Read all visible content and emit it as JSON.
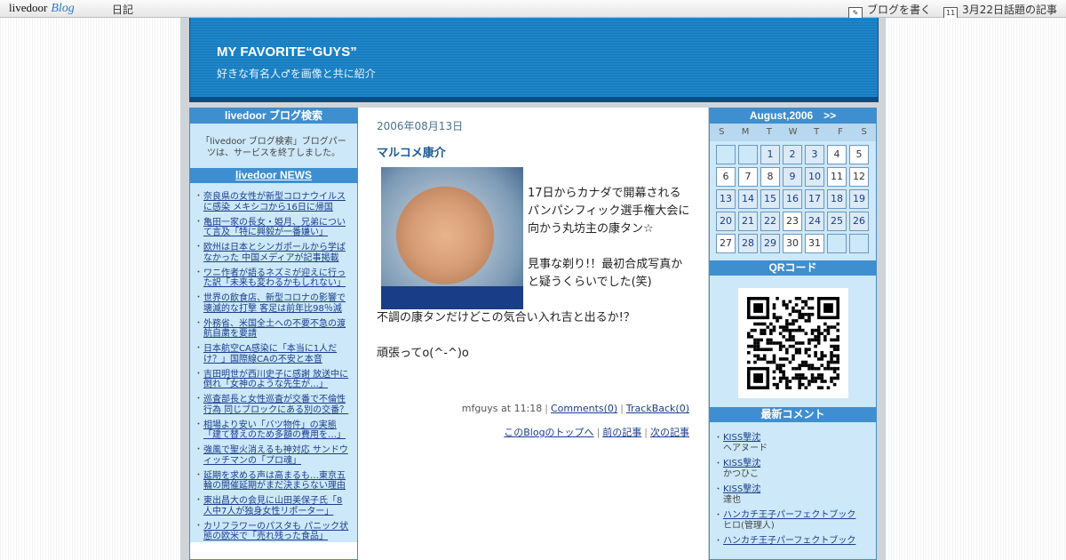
{
  "topbar": {
    "logo_main": "livedoor",
    "logo_blog": "Blog",
    "nav_diary": "日記",
    "write_blog": "ブログを書く",
    "topic_article": "3月22日話題の記事",
    "calendar_icon_day": "11"
  },
  "header": {
    "title": "MY FAVORITE“GUYS”",
    "description": "好きな有名人♂を画像と共に紹介"
  },
  "left": {
    "search_head": "livedoor ブログ検索",
    "search_message": "「livedoor ブログ検索」ブログパーツは、サービスを終了しました。",
    "news_head": "livedoor NEWS",
    "news": [
      "奈良県の女性が新型コロナウイルスに感染 メキシコから16日に帰国",
      "亀田一家の長女・姫月、兄弟について言及「特に興毅が一番嫌い」",
      "欧州は日本とシンガポールから学ばなかった 中国メディアが記事掲載",
      "ワニ作者が語るネズミが迎えに行った訳「未来も変わるかもしれない」",
      "世界の飲食店、新型コロナの影響で壊滅的な打撃 客足は前年比98％減",
      "外務省、米国全土への不要不急の渡航自粛を要請",
      "日本航空CA感染に「本当に1人だけ？」国際線CAの不安と本音",
      "吉田明世が西川史子に感謝 放送中に倒れ「女神のような先生が…」",
      "巡査部長と女性巡査が交番で不倫性行為 同じブロックにある別の交番？",
      "相場より安い「バツ物件」の実態「建て替えのため多額の費用を…」",
      "強風で聖火消えるも神対応 サンドウィッチマンの「プロ魂」",
      "延期を求める声は高まるも…東京五輪の開催延期がまだ決まらない理由",
      "東出昌大の会見に山田美保子氏「8人中7人が独身女性リポーター」",
      "カリフラワーのパスタも パニック状態の欧米で「売れ残った食品」"
    ]
  },
  "post": {
    "date": "2006年08月13日",
    "title": "マルコメ康介",
    "text1": "17日からカナダで開幕されるパンパシフィック選手権大会に向かう丸坊主の康タン☆",
    "text2": "見事な剃り!！最初合成写真かと疑うくらいでした(笑)",
    "text3": "不調の康タンだけどこの気合い入れ吉と出るか!？",
    "text4": "頑張ってo(^-^)o",
    "author_time": "mfguys at 11:18",
    "comments": "Comments(0)",
    "trackback": "TrackBack(0)",
    "nav_top": "このBlogのトップへ",
    "nav_prev": "前の記事",
    "nav_next": "次の記事"
  },
  "right": {
    "calendar_month": "August,2006",
    "calendar_next": ">>",
    "weekdays": [
      "S",
      "M",
      "T",
      "W",
      "T",
      "F",
      "S"
    ],
    "calendar_days": [
      "",
      "",
      "1",
      "2",
      "3",
      "4",
      "5",
      "6",
      "7",
      "8",
      "9",
      "10",
      "11",
      "12",
      "13",
      "14",
      "15",
      "16",
      "17",
      "18",
      "19",
      "20",
      "21",
      "22",
      "23",
      "24",
      "25",
      "26",
      "27",
      "28",
      "29",
      "30",
      "31",
      "",
      ""
    ],
    "qr_head": "QRコード",
    "comments_head": "最新コメント",
    "comments": [
      {
        "title": "KISS撃沈",
        "author": "ヘアヌード"
      },
      {
        "title": "KISS撃沈",
        "author": "かつひこ"
      },
      {
        "title": "KISS撃沈",
        "author": "達也"
      },
      {
        "title": "ハンカチ王子パーフェクトブック",
        "author": "ヒロ(管理人)"
      },
      {
        "title": "ハンカチ王子パーフェクトブック",
        "author": ""
      }
    ]
  }
}
